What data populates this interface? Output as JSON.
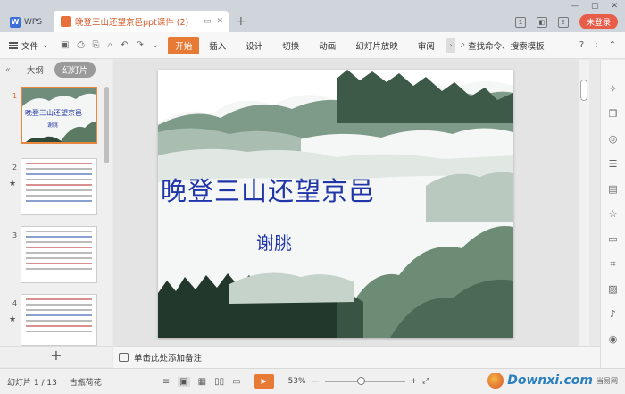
{
  "titlebar": {
    "app_tab": "WPS",
    "doc_tab": "晚登三山还望京邑ppt课件 (2)",
    "new_tab_symbol": "+",
    "page_badge": "1",
    "login_label": "未登录"
  },
  "menubar": {
    "file_label": "文件",
    "start_label": "开始",
    "items": [
      "插入",
      "设计",
      "切换",
      "动画",
      "幻灯片放映",
      "审阅"
    ],
    "search_label": "查找命令、搜索模板",
    "help_symbol": "?",
    "more_symbol": ":"
  },
  "left_panel": {
    "tab_outline": "大纲",
    "tab_slides": "幻灯片",
    "collapse_symbol": "«",
    "thumbnails": [
      {
        "number": "1",
        "title": "晚登三山还望京邑",
        "author": "谢朓",
        "active": true
      },
      {
        "number": "2",
        "active": false
      },
      {
        "number": "3",
        "active": false
      },
      {
        "number": "4",
        "active": false
      }
    ],
    "add_symbol": "+"
  },
  "slide": {
    "title": "晚登三山还望京邑",
    "author": "谢朓"
  },
  "notes": {
    "placeholder": "单击此处添加备注"
  },
  "statusbar": {
    "slide_counter": "幻灯片 1 / 13",
    "theme_name": "古瓶荷花",
    "zoom_level": "53%",
    "zoom_fraction": 0.45,
    "watermark_text": "Downxi.com",
    "watermark_sub": "当易网"
  },
  "colors": {
    "accent_orange": "#e77b36",
    "title_blue": "#2035a8",
    "login_red": "#e85c4a"
  }
}
